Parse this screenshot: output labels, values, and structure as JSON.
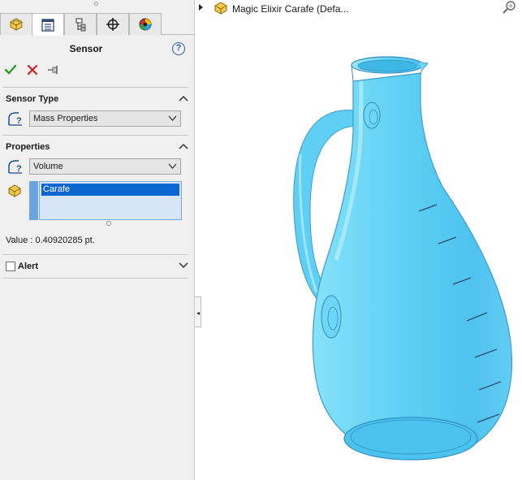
{
  "property_manager": {
    "tabs": [
      {
        "name": "feature-manager",
        "icon": "part-icon"
      },
      {
        "name": "property-manager",
        "icon": "property-manager-icon"
      },
      {
        "name": "configuration-manager",
        "icon": "configuration-icon"
      },
      {
        "name": "dimxpert-manager",
        "icon": "dimxpert-icon"
      },
      {
        "name": "display-manager",
        "icon": "appearance-icon"
      }
    ],
    "active_tab": 1,
    "title": "Sensor",
    "help_icon": "?",
    "actions": [
      "ok-icon",
      "cancel-icon",
      "pushpin-icon"
    ]
  },
  "sensor_type": {
    "heading": "Sensor Type",
    "selected": "Mass Properties"
  },
  "properties": {
    "heading": "Properties",
    "selected": "Volume",
    "selection_list": [
      "Carafe"
    ]
  },
  "value_text": "Value : 0.40920285 pt.",
  "alert": {
    "label": "Alert",
    "checked": false
  },
  "graphics": {
    "breadcrumb_text": "Magic Elixir Carafe  (Defa...",
    "model_color": "#5fd0f4"
  },
  "colors": {
    "accent": "#0c66d1",
    "ok": "#2e9b2e",
    "cancel": "#d02020"
  }
}
